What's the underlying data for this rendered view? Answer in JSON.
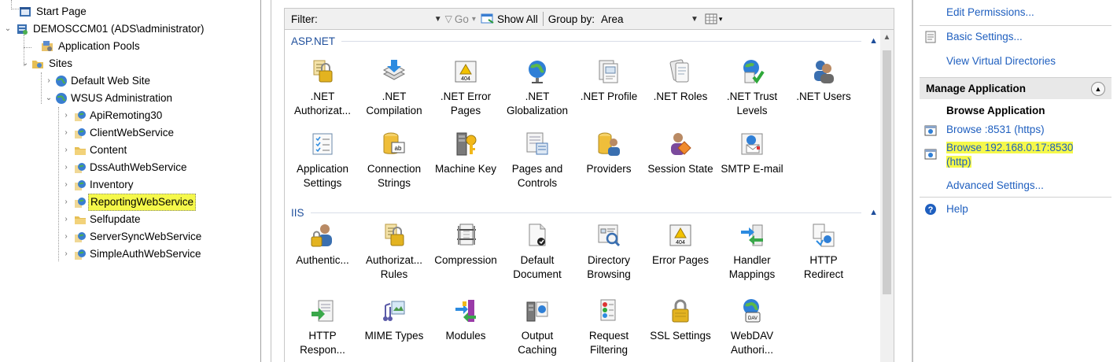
{
  "tree": {
    "start_page": "Start Page",
    "server": "DEMOSCCM01 (ADS\\administrator)",
    "app_pools": "Application Pools",
    "sites": "Sites",
    "default_site": "Default Web Site",
    "wsus": "WSUS Administration",
    "children": [
      "ApiRemoting30",
      "ClientWebService",
      "Content",
      "DssAuthWebService",
      "Inventory",
      "ReportingWebService",
      "Selfupdate",
      "ServerSyncWebService",
      "SimpleAuthWebService"
    ],
    "selected": "ReportingWebService"
  },
  "toolbar": {
    "filter_label": "Filter:",
    "go_label": "Go",
    "show_all_label": "Show All",
    "group_by_label": "Group by:",
    "group_by_value": "Area"
  },
  "groups": {
    "aspnet": {
      "title": "ASP.NET",
      "features": [
        {
          "label": ".NET\nAuthorizat...",
          "icon": "net-authorization-icon"
        },
        {
          "label": ".NET\nCompilation",
          "icon": "net-compilation-icon"
        },
        {
          "label": ".NET Error\nPages",
          "icon": "net-error-pages-icon"
        },
        {
          "label": ".NET\nGlobalization",
          "icon": "net-globalization-icon"
        },
        {
          "label": ".NET Profile",
          "icon": "net-profile-icon"
        },
        {
          "label": ".NET Roles",
          "icon": "net-roles-icon"
        },
        {
          "label": ".NET Trust\nLevels",
          "icon": "net-trust-levels-icon"
        },
        {
          "label": ".NET Users",
          "icon": "net-users-icon"
        },
        {
          "label": "Application\nSettings",
          "icon": "application-settings-icon"
        },
        {
          "label": "Connection\nStrings",
          "icon": "connection-strings-icon"
        },
        {
          "label": "Machine Key",
          "icon": "machine-key-icon"
        },
        {
          "label": "Pages and\nControls",
          "icon": "pages-and-controls-icon"
        },
        {
          "label": "Providers",
          "icon": "providers-icon"
        },
        {
          "label": "Session State",
          "icon": "session-state-icon"
        },
        {
          "label": "SMTP E-mail",
          "icon": "smtp-email-icon"
        }
      ]
    },
    "iis": {
      "title": "IIS",
      "features": [
        {
          "label": "Authentic...",
          "icon": "authentication-icon"
        },
        {
          "label": "Authorizat...\nRules",
          "icon": "authorization-rules-icon"
        },
        {
          "label": "Compression",
          "icon": "compression-icon"
        },
        {
          "label": "Default\nDocument",
          "icon": "default-document-icon"
        },
        {
          "label": "Directory\nBrowsing",
          "icon": "directory-browsing-icon"
        },
        {
          "label": "Error Pages",
          "icon": "error-pages-icon"
        },
        {
          "label": "Handler\nMappings",
          "icon": "handler-mappings-icon"
        },
        {
          "label": "HTTP\nRedirect",
          "icon": "http-redirect-icon"
        },
        {
          "label": "HTTP\nRespon...",
          "icon": "http-response-icon"
        },
        {
          "label": "MIME Types",
          "icon": "mime-types-icon"
        },
        {
          "label": "Modules",
          "icon": "modules-icon"
        },
        {
          "label": "Output\nCaching",
          "icon": "output-caching-icon"
        },
        {
          "label": "Request\nFiltering",
          "icon": "request-filtering-icon"
        },
        {
          "label": "SSL Settings",
          "icon": "ssl-settings-icon"
        },
        {
          "label": "WebDAV\nAuthori...",
          "icon": "webdav-authoring-icon"
        }
      ]
    }
  },
  "actions": {
    "edit_permissions": "Edit Permissions...",
    "basic_settings": "Basic Settings...",
    "view_virtual_dirs": "View Virtual Directories",
    "manage_application": "Manage Application",
    "browse_application": "Browse Application",
    "browse_https": "Browse :8531 (https)",
    "browse_http_line1": "Browse 192.168.0.17:8530",
    "browse_http_line2": "(http)",
    "advanced_settings": "Advanced Settings...",
    "help": "Help"
  },
  "colors": {
    "link": "#1f5fbf",
    "highlight": "#f5f84a",
    "group_header": "#1e4e9b"
  }
}
